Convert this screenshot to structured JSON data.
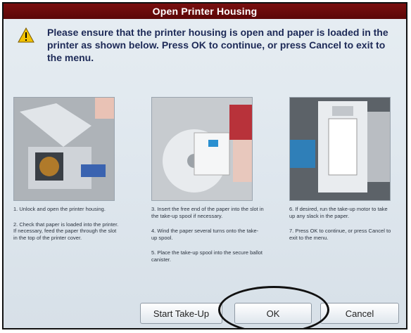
{
  "dialog": {
    "title": "Open Printer Housing",
    "message": "Please ensure that the printer housing is open and paper is loaded in the printer as shown below. Press OK to continue, or press Cancel to exit to the menu.",
    "icon": "warning-icon"
  },
  "steps": {
    "col1": [
      "1. Unlock and open the printer housing.",
      "2. Check that paper is loaded into the printer. If necessary, feed the paper through the slot in the top of the printer cover."
    ],
    "col2": [
      "3. Insert the free end of the paper into the slot in the take-up spool if necessary.",
      "4. Wind the paper several turns onto the take-up spool.",
      "5. Place the take-up spool into the secure ballot canister."
    ],
    "col3": [
      "6. If desired, run the take-up motor to take up any slack in the paper.",
      "7. Press OK to continue, or press Cancel to exit to the menu."
    ]
  },
  "buttons": {
    "take_up": "Start Take-Up",
    "ok": "OK",
    "cancel": "Cancel"
  },
  "colors": {
    "titlebar": "#6a0b0b",
    "message_text": "#1d2a57",
    "warning_fill": "#f2c200"
  }
}
